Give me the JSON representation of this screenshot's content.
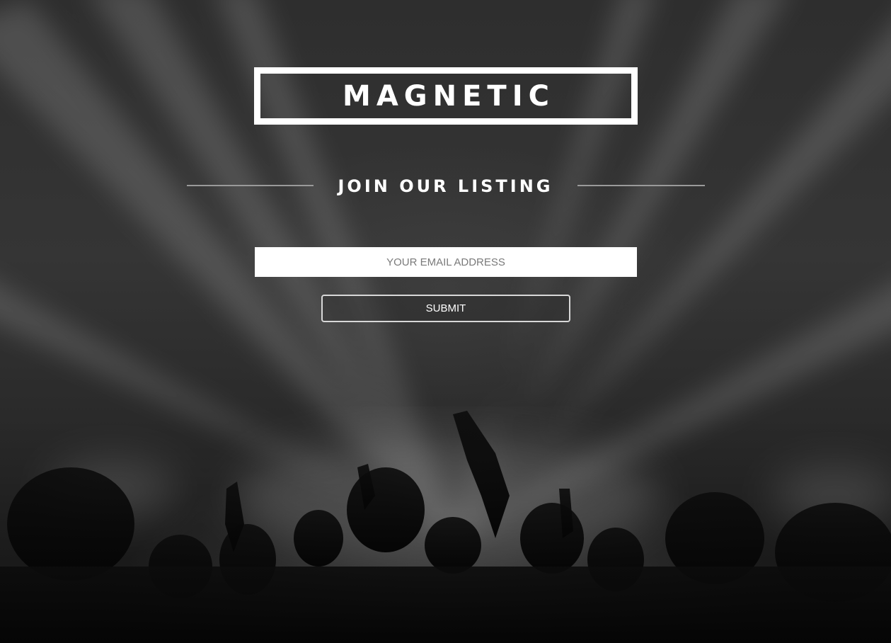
{
  "brand": {
    "logo_text": "MAGNETIC"
  },
  "signup": {
    "heading": "JOIN OUR LISTING",
    "email_placeholder": "YOUR EMAIL ADDRESS",
    "email_value": "",
    "submit_label": "SUBMIT"
  },
  "background": {
    "image": "concert-crowd-photo"
  },
  "colors": {
    "text": "#ffffff",
    "rule": "#9a9a9a",
    "input_background": "#ffffff",
    "placeholder": "#7a7a7a",
    "button_border": "#d8d8d8"
  }
}
